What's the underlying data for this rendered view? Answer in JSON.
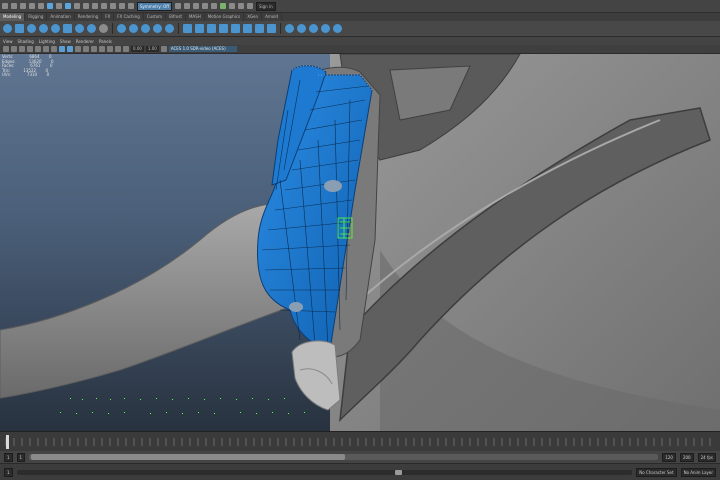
{
  "statusline": {
    "panel_field": "Symmetry: Off",
    "snap_field": "Sign in"
  },
  "shelf": {
    "tabs": [
      "Modeling",
      "Rigging",
      "Animation",
      "Rendering",
      "FX",
      "FX Caching",
      "Custom",
      "Bifrost",
      "MASH",
      "Motion Graphics",
      "XGen",
      "Arnold"
    ],
    "active_tab": "Modeling"
  },
  "panel_menu": [
    "View",
    "Shading",
    "Lighting",
    "Show",
    "Renderer",
    "Panels"
  ],
  "panel_toolbar": {
    "field_a": "0.00",
    "field_b": "1.00",
    "color_space": "ACES 1.0 SDR-video (ACES)"
  },
  "hud": {
    "rows": [
      {
        "label": "Verts:",
        "value": "6864",
        "extra": "0"
      },
      {
        "label": "Edges:",
        "value": "13620",
        "extra": "0"
      },
      {
        "label": "Faces:",
        "value": "6761",
        "extra": "0"
      },
      {
        "label": "Tris:",
        "value": "13522",
        "extra": "0"
      },
      {
        "label": "UVs:",
        "value": "7310",
        "extra": "0"
      }
    ]
  },
  "range": {
    "start": "1",
    "playback_start": "1",
    "playback_end": "120",
    "end": "200",
    "fps": "24 fps"
  },
  "bottom": {
    "current_frame": "1",
    "character_set": "No Character Set",
    "anim_layer": "No Anim Layer"
  },
  "colors": {
    "selection_blue": "#1c7dd6",
    "component_green": "#5cff3a",
    "viewport_bg_top": "#5f7591",
    "viewport_bg_bottom": "#28323f",
    "mesh_gray": "#8c8c8c"
  }
}
